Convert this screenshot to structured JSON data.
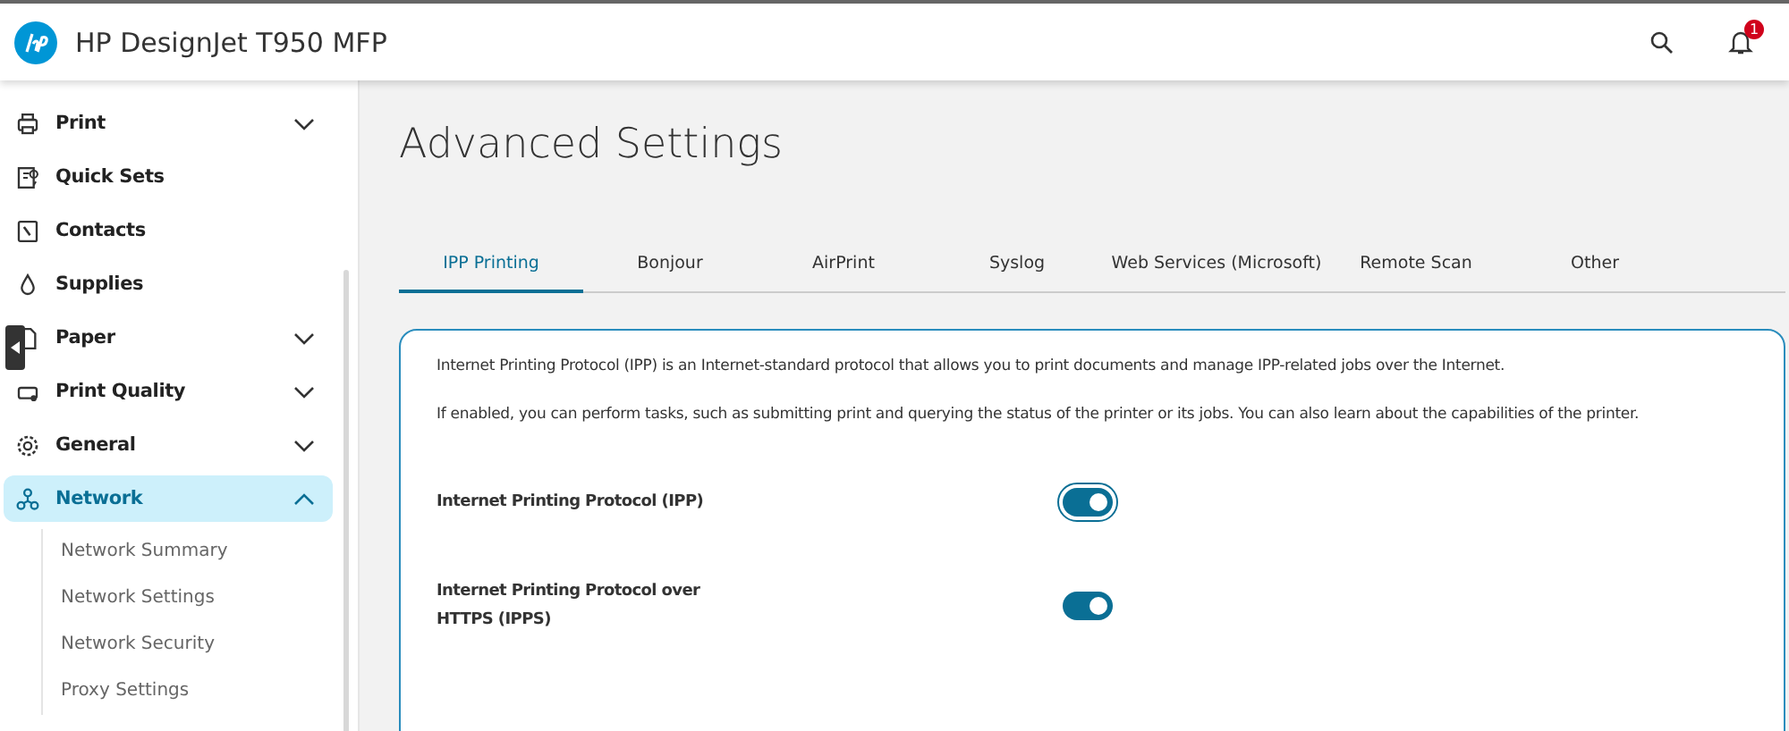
{
  "header": {
    "title": "HP DesignJet T950 MFP",
    "notification_count": "1"
  },
  "sidebar": {
    "items": [
      {
        "label": "Print",
        "expanded": false,
        "selected": false
      },
      {
        "label": "Quick Sets",
        "selected": false
      },
      {
        "label": "Contacts",
        "selected": false
      },
      {
        "label": "Supplies",
        "selected": false
      },
      {
        "label": "Paper",
        "expanded": false,
        "selected": false
      },
      {
        "label": "Print Quality",
        "expanded": false,
        "selected": false
      },
      {
        "label": "General",
        "expanded": false,
        "selected": false
      },
      {
        "label": "Network",
        "expanded": true,
        "selected": true,
        "children": [
          {
            "label": "Network Summary",
            "selected": false
          },
          {
            "label": "Network Settings",
            "selected": false
          },
          {
            "label": "Network Security",
            "selected": false
          },
          {
            "label": "Proxy Settings",
            "selected": false
          }
        ]
      }
    ]
  },
  "page": {
    "title": "Advanced Settings",
    "tabs": [
      {
        "label": "IPP Printing",
        "selected": true
      },
      {
        "label": "Bonjour",
        "selected": false
      },
      {
        "label": "AirPrint",
        "selected": false
      },
      {
        "label": "Syslog",
        "selected": false
      },
      {
        "label": "Web Services (Microsoft)",
        "selected": false
      },
      {
        "label": "Remote Scan",
        "selected": false
      },
      {
        "label": "Other",
        "selected": false
      }
    ],
    "paragraphs": [
      "Internet Printing Protocol (IPP) is an Internet-standard protocol that allows you to print documents and manage IPP-related jobs over the Internet.",
      "If enabled, you can perform tasks, such as submitting print and querying the status of the printer or its jobs. You can also learn about the capabilities of the printer."
    ],
    "settings": [
      {
        "label": "Internet Printing Protocol (IPP)",
        "on": true,
        "focused": true
      },
      {
        "label": "Internet Printing Protocol over HTTPS (IPPS)",
        "on": true,
        "focused": false
      }
    ]
  }
}
